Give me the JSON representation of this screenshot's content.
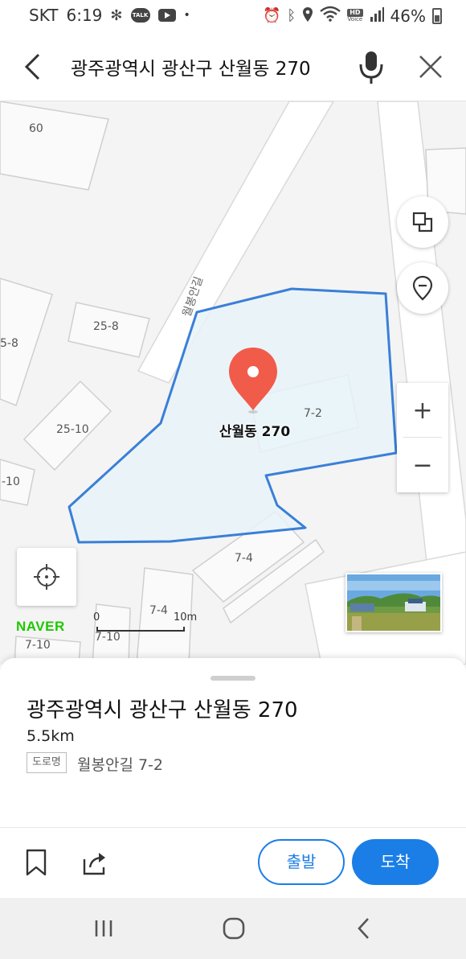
{
  "status_bar": {
    "carrier": "SKT",
    "time": "6:19",
    "battery": "46%",
    "hd_label": "HD",
    "voice_label": "Voice",
    "talk_label": "TALK",
    "dot": "•"
  },
  "search": {
    "query": "광주광역시 광산구 산월동 270"
  },
  "map": {
    "road_name": "월봉안길",
    "building_labels": [
      "60",
      "25-8",
      "5-8",
      "25-10",
      "-10",
      "7-2",
      "7-4",
      "7-4",
      "7-10",
      "7-10"
    ],
    "pin_label": "산월동 270",
    "zoom_in": "+",
    "zoom_out": "−",
    "logo": "NAVER",
    "scale_min": "0",
    "scale_max": "10m",
    "colors": {
      "parcel_outline": "#3a7fd8",
      "parcel_fill": "#e8f3f8",
      "pin": "#f15b4a",
      "naver_green": "#1ec800"
    }
  },
  "place": {
    "title": "광주광역시 광산구 산월동 270",
    "distance": "5.5km",
    "road_tag": "도로명",
    "road_address": "월봉안길 7-2"
  },
  "actions": {
    "depart": "출발",
    "arrive": "도착",
    "accent": "#1a7ee6"
  }
}
